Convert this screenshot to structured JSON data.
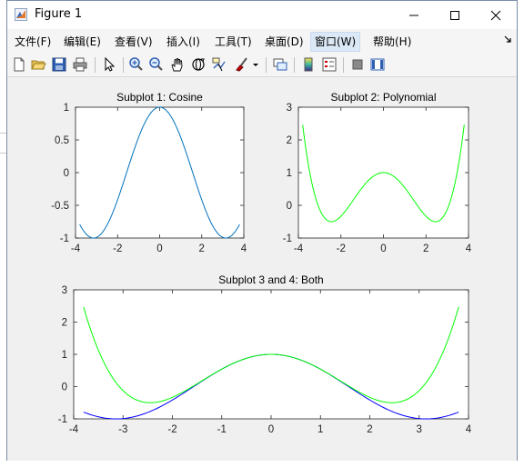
{
  "window": {
    "title": "Figure 1",
    "controls": [
      "minimize",
      "maximize",
      "close"
    ]
  },
  "menu": {
    "items": [
      {
        "label": "文件(F)"
      },
      {
        "label": "编辑(E)"
      },
      {
        "label": "查看(V)"
      },
      {
        "label": "插入(I)"
      },
      {
        "label": "工具(T)"
      },
      {
        "label": "桌面(D)"
      },
      {
        "label": "窗口(W)"
      },
      {
        "label": "帮助(H)"
      }
    ],
    "active": "窗口(W)"
  },
  "toolbar": {
    "icons": [
      "new-figure-icon",
      "open-icon",
      "save-icon",
      "print-icon",
      "select-arrow-icon",
      "zoom-in-icon",
      "zoom-out-icon",
      "pan-hand-icon",
      "rotate-3d-icon",
      "data-cursor-icon",
      "brush-icon",
      "link-plot-icon",
      "colorbar-icon",
      "legend-icon",
      "hide-plot-tools-icon",
      "show-plot-tools-icon"
    ]
  },
  "chart_data": [
    {
      "type": "line",
      "title": "Subplot 1: Cosine",
      "xlabel": "",
      "ylabel": "",
      "xlim": [
        -4,
        4
      ],
      "ylim": [
        -1,
        1
      ],
      "xticks": [
        -4,
        -2,
        0,
        2,
        4
      ],
      "yticks": [
        -1,
        -0.5,
        0,
        0.5,
        1
      ],
      "series": [
        {
          "function": "cos(x)",
          "x_range": [
            -3.8,
            3.8
          ],
          "color": "#0072bd"
        }
      ]
    },
    {
      "type": "line",
      "title": "Subplot 2: Polynomial",
      "xlabel": "",
      "ylabel": "",
      "xlim": [
        -4,
        4
      ],
      "ylim": [
        -1,
        3
      ],
      "xticks": [
        -4,
        -2,
        0,
        2,
        4
      ],
      "yticks": [
        -1,
        0,
        1,
        2,
        3
      ],
      "series": [
        {
          "function": "1 - x^2/2 + x^4/24",
          "x_range": [
            -3.8,
            3.8
          ],
          "color": "#00ff00"
        }
      ]
    },
    {
      "type": "line",
      "title": "Subplot 3 and 4: Both",
      "xlabel": "",
      "ylabel": "",
      "xlim": [
        -4,
        4
      ],
      "ylim": [
        -1,
        3
      ],
      "xticks": [
        -4,
        -3,
        -2,
        -1,
        0,
        1,
        2,
        3,
        4
      ],
      "yticks": [
        -1,
        0,
        1,
        2,
        3
      ],
      "series": [
        {
          "function": "cos(x)",
          "x_range": [
            -3.8,
            3.8
          ],
          "color": "#0000ff"
        },
        {
          "function": "1 - x^2/2 + x^4/24",
          "x_range": [
            -3.8,
            3.8
          ],
          "color": "#00ff00"
        }
      ]
    }
  ]
}
